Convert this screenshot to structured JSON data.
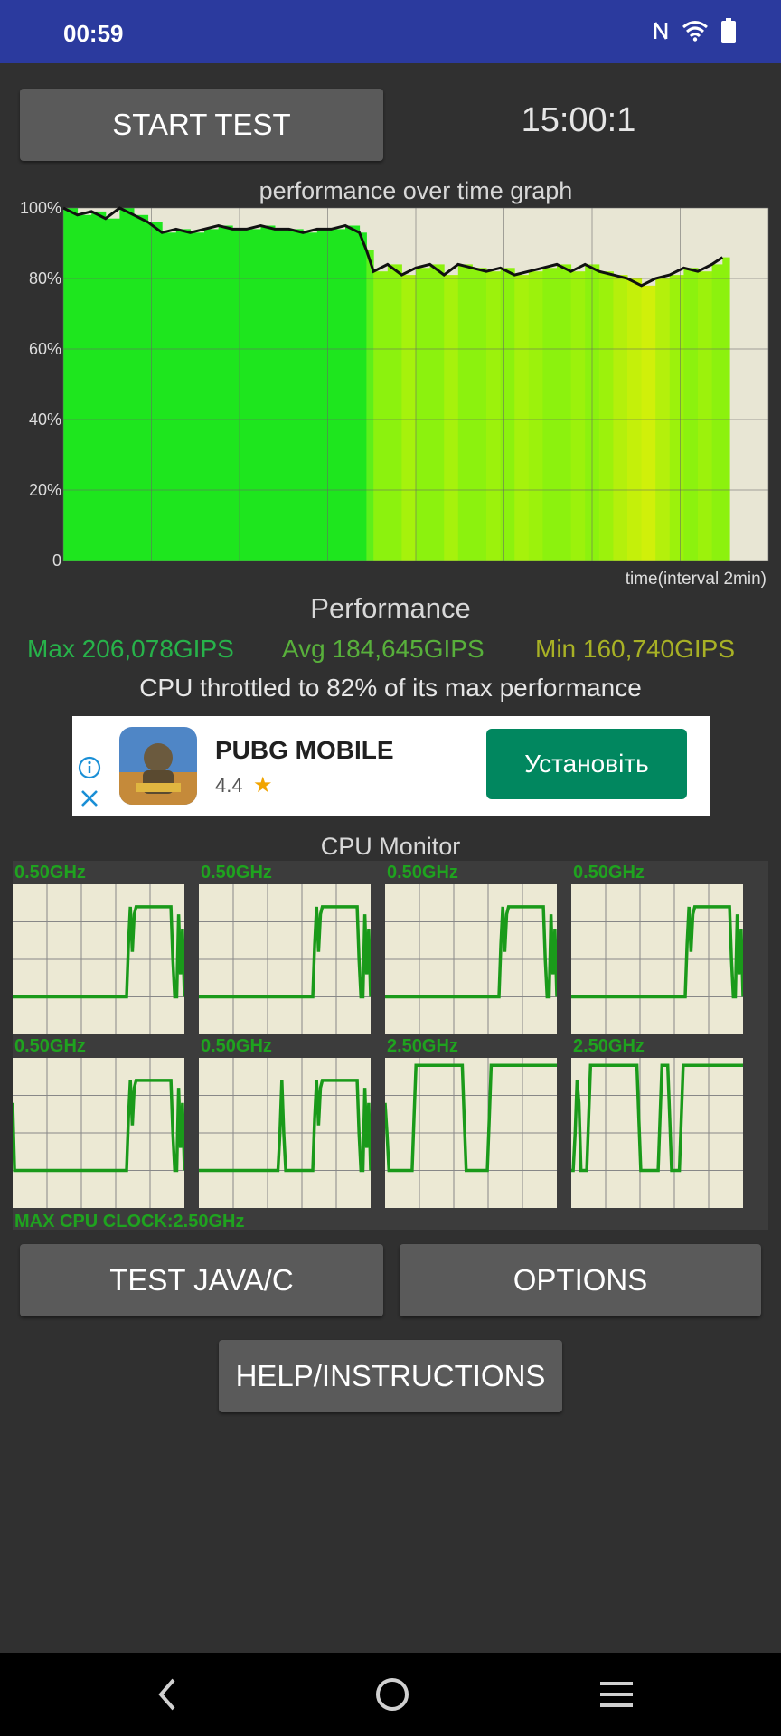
{
  "status_bar": {
    "time": "00:59",
    "icons": [
      "nfc-icon",
      "wifi-icon",
      "battery-icon"
    ]
  },
  "toolbar": {
    "start_label": "START TEST",
    "timer": "15:00:1"
  },
  "graph": {
    "title": "performance over time graph",
    "xlabel": "time(interval 2min)",
    "y_ticks": [
      "100%",
      "80%",
      "60%",
      "40%",
      "20%",
      "0"
    ]
  },
  "chart_data": {
    "type": "area",
    "title": "performance over time graph",
    "xlabel": "time(interval 2min)",
    "ylabel": "",
    "ylim": [
      0,
      100
    ],
    "y_ticks": [
      0,
      20,
      40,
      60,
      80,
      100
    ],
    "grid": true,
    "x_fraction": [
      0,
      0.02,
      0.04,
      0.06,
      0.08,
      0.1,
      0.12,
      0.14,
      0.16,
      0.18,
      0.2,
      0.22,
      0.24,
      0.26,
      0.28,
      0.3,
      0.32,
      0.34,
      0.36,
      0.38,
      0.4,
      0.42,
      0.43,
      0.44,
      0.46,
      0.48,
      0.5,
      0.52,
      0.54,
      0.56,
      0.58,
      0.6,
      0.62,
      0.64,
      0.66,
      0.68,
      0.7,
      0.72,
      0.74,
      0.76,
      0.78,
      0.8,
      0.82,
      0.84,
      0.86,
      0.88,
      0.9,
      0.92,
      0.935
    ],
    "y": [
      100,
      98,
      99,
      97,
      100,
      98,
      96,
      93,
      94,
      93,
      94,
      95,
      94,
      94,
      95,
      94,
      94,
      93,
      94,
      94,
      95,
      93,
      88,
      82,
      84,
      81,
      83,
      84,
      81,
      84,
      83,
      82,
      83,
      81,
      82,
      83,
      84,
      82,
      84,
      82,
      81,
      80,
      78,
      80,
      81,
      83,
      82,
      84,
      86
    ],
    "fill_colors": [
      "#1ee61e",
      "#1ee61e",
      "#1ee61e",
      "#1ee61e",
      "#1ee61e",
      "#1ee61e",
      "#1ee61e",
      "#1ee61e",
      "#1ee61e",
      "#1ee61e",
      "#1ee61e",
      "#1ee61e",
      "#1ee61e",
      "#1ee61e",
      "#1ee61e",
      "#1ee61e",
      "#1ee61e",
      "#1ee61e",
      "#1ee61e",
      "#1ee61e",
      "#1ee61e",
      "#1ee61e",
      "#5ef01a",
      "#8cf20e",
      "#8cf20e",
      "#a6f20c",
      "#8cf20e",
      "#8cf20e",
      "#a6f20c",
      "#8cf20e",
      "#8cf20e",
      "#9cf20c",
      "#8cf20e",
      "#a6f20c",
      "#9cf20c",
      "#8cf20e",
      "#8cf20e",
      "#9cf20c",
      "#8cf20e",
      "#9cf20c",
      "#b4f00c",
      "#c4f00a",
      "#d0f00a",
      "#b4f00c",
      "#9cf20c",
      "#8cf20e",
      "#9cf20c",
      "#8cf20e",
      "#8cf20e"
    ],
    "plot_bg": "#e8e6d4"
  },
  "performance": {
    "heading": "Performance",
    "max": "Max 206,078GIPS",
    "avg": "Avg 184,645GIPS",
    "min": "Min 160,740GIPS",
    "throttle_text": "CPU throttled to 82% of its max performance"
  },
  "ad": {
    "app_name": "PUBG MOBILE",
    "rating": "4.4",
    "install_label": "Установіть"
  },
  "cpu_monitor": {
    "title": "CPU Monitor",
    "max_clock": "MAX CPU CLOCK:2.50GHz",
    "cores": [
      {
        "label": "0.50GHz",
        "levels": [
          0.25,
          0.25,
          0.25,
          0.25,
          0.25,
          0.25,
          0.25,
          0.25,
          0.25,
          0.25,
          0.25,
          0.25,
          0.25,
          0.25,
          0.25,
          0.25,
          0.25,
          0.25,
          0.25,
          0.25,
          0.25,
          0.25,
          0.25,
          0.25,
          0.25,
          0.25,
          0.25,
          0.25,
          0.25,
          0.25,
          0.25,
          0.25,
          0.25,
          0.25,
          0.25,
          0.25,
          0.25,
          0.25,
          0.25,
          0.25,
          0.25,
          0.25,
          0.25,
          0.25,
          0.25,
          0.25,
          0.25,
          0.25,
          0.25,
          0.25,
          0.25,
          0.25,
          0.25,
          0.25,
          0.25,
          0.25,
          0.25,
          0.25,
          0.25,
          0.25,
          0.6,
          0.85,
          0.55,
          0.8,
          0.85,
          0.85,
          0.85,
          0.85,
          0.85,
          0.85,
          0.85,
          0.85,
          0.85,
          0.85,
          0.85,
          0.85,
          0.85,
          0.85,
          0.85,
          0.85,
          0.85,
          0.85,
          0.85,
          0.5,
          0.25,
          0.25,
          0.8,
          0.4,
          0.7,
          0.25
        ]
      },
      {
        "label": "0.50GHz",
        "levels": [
          0.25,
          0.25,
          0.25,
          0.25,
          0.25,
          0.25,
          0.25,
          0.25,
          0.25,
          0.25,
          0.25,
          0.25,
          0.25,
          0.25,
          0.25,
          0.25,
          0.25,
          0.25,
          0.25,
          0.25,
          0.25,
          0.25,
          0.25,
          0.25,
          0.25,
          0.25,
          0.25,
          0.25,
          0.25,
          0.25,
          0.25,
          0.25,
          0.25,
          0.25,
          0.25,
          0.25,
          0.25,
          0.25,
          0.25,
          0.25,
          0.25,
          0.25,
          0.25,
          0.25,
          0.25,
          0.25,
          0.25,
          0.25,
          0.25,
          0.25,
          0.25,
          0.25,
          0.25,
          0.25,
          0.25,
          0.25,
          0.25,
          0.25,
          0.25,
          0.25,
          0.6,
          0.85,
          0.55,
          0.8,
          0.85,
          0.85,
          0.85,
          0.85,
          0.85,
          0.85,
          0.85,
          0.85,
          0.85,
          0.85,
          0.85,
          0.85,
          0.85,
          0.85,
          0.85,
          0.85,
          0.85,
          0.85,
          0.85,
          0.5,
          0.25,
          0.25,
          0.8,
          0.4,
          0.7,
          0.25
        ]
      },
      {
        "label": "0.50GHz",
        "levels": [
          0.25,
          0.25,
          0.25,
          0.25,
          0.25,
          0.25,
          0.25,
          0.25,
          0.25,
          0.25,
          0.25,
          0.25,
          0.25,
          0.25,
          0.25,
          0.25,
          0.25,
          0.25,
          0.25,
          0.25,
          0.25,
          0.25,
          0.25,
          0.25,
          0.25,
          0.25,
          0.25,
          0.25,
          0.25,
          0.25,
          0.25,
          0.25,
          0.25,
          0.25,
          0.25,
          0.25,
          0.25,
          0.25,
          0.25,
          0.25,
          0.25,
          0.25,
          0.25,
          0.25,
          0.25,
          0.25,
          0.25,
          0.25,
          0.25,
          0.25,
          0.25,
          0.25,
          0.25,
          0.25,
          0.25,
          0.25,
          0.25,
          0.25,
          0.25,
          0.25,
          0.6,
          0.85,
          0.55,
          0.8,
          0.85,
          0.85,
          0.85,
          0.85,
          0.85,
          0.85,
          0.85,
          0.85,
          0.85,
          0.85,
          0.85,
          0.85,
          0.85,
          0.85,
          0.85,
          0.85,
          0.85,
          0.85,
          0.85,
          0.5,
          0.25,
          0.25,
          0.8,
          0.4,
          0.7,
          0.25
        ]
      },
      {
        "label": "0.50GHz",
        "levels": [
          0.25,
          0.25,
          0.25,
          0.25,
          0.25,
          0.25,
          0.25,
          0.25,
          0.25,
          0.25,
          0.25,
          0.25,
          0.25,
          0.25,
          0.25,
          0.25,
          0.25,
          0.25,
          0.25,
          0.25,
          0.25,
          0.25,
          0.25,
          0.25,
          0.25,
          0.25,
          0.25,
          0.25,
          0.25,
          0.25,
          0.25,
          0.25,
          0.25,
          0.25,
          0.25,
          0.25,
          0.25,
          0.25,
          0.25,
          0.25,
          0.25,
          0.25,
          0.25,
          0.25,
          0.25,
          0.25,
          0.25,
          0.25,
          0.25,
          0.25,
          0.25,
          0.25,
          0.25,
          0.25,
          0.25,
          0.25,
          0.25,
          0.25,
          0.25,
          0.25,
          0.6,
          0.85,
          0.55,
          0.8,
          0.85,
          0.85,
          0.85,
          0.85,
          0.85,
          0.85,
          0.85,
          0.85,
          0.85,
          0.85,
          0.85,
          0.85,
          0.85,
          0.85,
          0.85,
          0.85,
          0.85,
          0.85,
          0.85,
          0.5,
          0.25,
          0.25,
          0.8,
          0.4,
          0.7,
          0.25
        ]
      },
      {
        "label": "0.50GHz",
        "levels": [
          0.7,
          0.25,
          0.25,
          0.25,
          0.25,
          0.25,
          0.25,
          0.25,
          0.25,
          0.25,
          0.25,
          0.25,
          0.25,
          0.25,
          0.25,
          0.25,
          0.25,
          0.25,
          0.25,
          0.25,
          0.25,
          0.25,
          0.25,
          0.25,
          0.25,
          0.25,
          0.25,
          0.25,
          0.25,
          0.25,
          0.25,
          0.25,
          0.25,
          0.25,
          0.25,
          0.25,
          0.25,
          0.25,
          0.25,
          0.25,
          0.25,
          0.25,
          0.25,
          0.25,
          0.25,
          0.25,
          0.25,
          0.25,
          0.25,
          0.25,
          0.25,
          0.25,
          0.25,
          0.25,
          0.25,
          0.25,
          0.25,
          0.25,
          0.25,
          0.25,
          0.6,
          0.85,
          0.55,
          0.8,
          0.85,
          0.85,
          0.85,
          0.85,
          0.85,
          0.85,
          0.85,
          0.85,
          0.85,
          0.85,
          0.85,
          0.85,
          0.85,
          0.85,
          0.85,
          0.85,
          0.85,
          0.85,
          0.85,
          0.5,
          0.25,
          0.25,
          0.8,
          0.4,
          0.7,
          0.25
        ]
      },
      {
        "label": "0.50GHz",
        "levels": [
          0.25,
          0.25,
          0.25,
          0.25,
          0.25,
          0.25,
          0.25,
          0.25,
          0.25,
          0.25,
          0.25,
          0.25,
          0.25,
          0.25,
          0.25,
          0.25,
          0.25,
          0.25,
          0.25,
          0.25,
          0.25,
          0.25,
          0.25,
          0.25,
          0.25,
          0.25,
          0.25,
          0.25,
          0.25,
          0.25,
          0.25,
          0.25,
          0.25,
          0.25,
          0.25,
          0.25,
          0.25,
          0.25,
          0.25,
          0.25,
          0.25,
          0.25,
          0.5,
          0.85,
          0.5,
          0.25,
          0.25,
          0.25,
          0.25,
          0.25,
          0.25,
          0.25,
          0.25,
          0.25,
          0.25,
          0.25,
          0.25,
          0.25,
          0.25,
          0.25,
          0.6,
          0.85,
          0.55,
          0.8,
          0.85,
          0.85,
          0.85,
          0.85,
          0.85,
          0.85,
          0.85,
          0.85,
          0.85,
          0.85,
          0.85,
          0.85,
          0.85,
          0.85,
          0.85,
          0.85,
          0.85,
          0.85,
          0.85,
          0.5,
          0.25,
          0.25,
          0.8,
          0.4,
          0.7,
          0.25
        ]
      },
      {
        "label": "2.50GHz",
        "levels": [
          0.7,
          0.5,
          0.25,
          0.25,
          0.25,
          0.25,
          0.25,
          0.25,
          0.25,
          0.25,
          0.25,
          0.25,
          0.25,
          0.25,
          0.25,
          0.6,
          0.95,
          0.95,
          0.95,
          0.95,
          0.95,
          0.95,
          0.95,
          0.95,
          0.95,
          0.95,
          0.95,
          0.95,
          0.95,
          0.95,
          0.95,
          0.95,
          0.95,
          0.95,
          0.95,
          0.95,
          0.95,
          0.95,
          0.95,
          0.95,
          0.95,
          0.6,
          0.25,
          0.25,
          0.25,
          0.25,
          0.25,
          0.25,
          0.25,
          0.25,
          0.25,
          0.25,
          0.25,
          0.25,
          0.6,
          0.95,
          0.95,
          0.95,
          0.95,
          0.95,
          0.95,
          0.95,
          0.95,
          0.95,
          0.95,
          0.95,
          0.95,
          0.95,
          0.95,
          0.95,
          0.95,
          0.95,
          0.95,
          0.95,
          0.95,
          0.95,
          0.95,
          0.95,
          0.95,
          0.95,
          0.95,
          0.95,
          0.95,
          0.95,
          0.95,
          0.95,
          0.95,
          0.95,
          0.95,
          0.95
        ]
      },
      {
        "label": "2.50GHz",
        "levels": [
          0.25,
          0.25,
          0.5,
          0.85,
          0.7,
          0.25,
          0.25,
          0.25,
          0.25,
          0.6,
          0.95,
          0.95,
          0.95,
          0.95,
          0.95,
          0.95,
          0.95,
          0.95,
          0.95,
          0.95,
          0.95,
          0.95,
          0.95,
          0.95,
          0.95,
          0.95,
          0.95,
          0.95,
          0.95,
          0.95,
          0.95,
          0.95,
          0.95,
          0.95,
          0.95,
          0.6,
          0.25,
          0.25,
          0.25,
          0.25,
          0.25,
          0.25,
          0.25,
          0.25,
          0.25,
          0.25,
          0.6,
          0.95,
          0.95,
          0.95,
          0.95,
          0.6,
          0.25,
          0.25,
          0.25,
          0.25,
          0.25,
          0.6,
          0.95,
          0.95,
          0.95,
          0.95,
          0.95,
          0.95,
          0.95,
          0.95,
          0.95,
          0.95,
          0.95,
          0.95,
          0.95,
          0.95,
          0.95,
          0.95,
          0.95,
          0.95,
          0.95,
          0.95,
          0.95,
          0.95,
          0.95,
          0.95,
          0.95,
          0.95,
          0.95,
          0.95,
          0.95,
          0.95,
          0.95,
          0.95
        ]
      }
    ]
  },
  "buttons": {
    "test_java": "TEST JAVA/C",
    "options": "OPTIONS",
    "help": "HELP/INSTRUCTIONS"
  },
  "nav": {
    "icons": [
      "back-icon",
      "home-icon",
      "recents-icon"
    ]
  }
}
